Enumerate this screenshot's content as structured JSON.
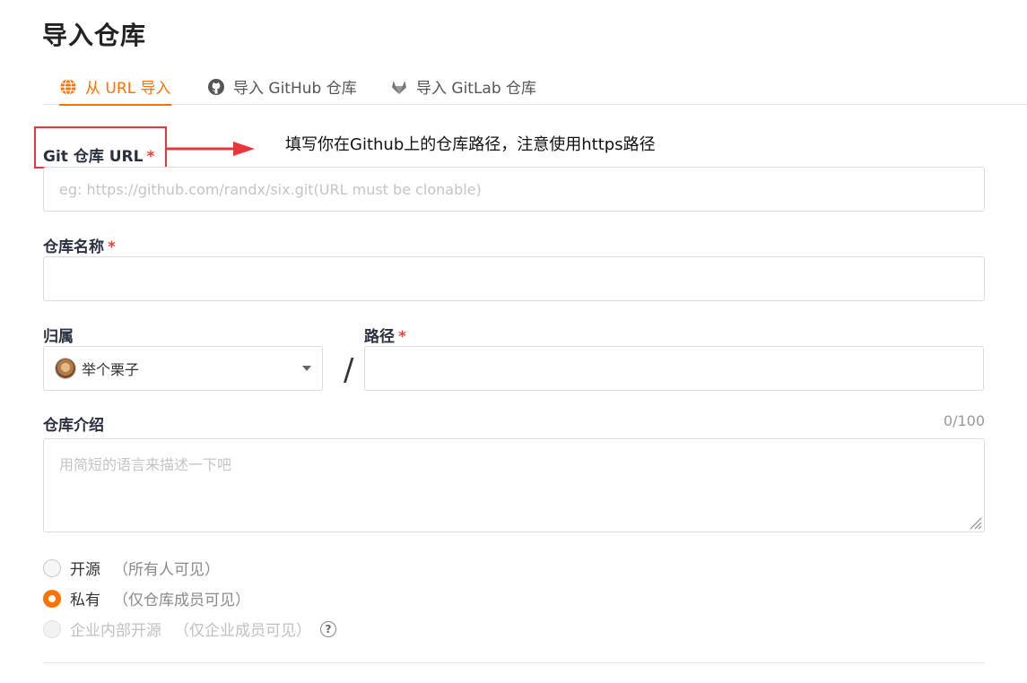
{
  "page": {
    "title": "导入仓库"
  },
  "tabs": [
    {
      "label": "从 URL 导入",
      "icon": "globe-icon"
    },
    {
      "label": "导入 GitHub 仓库",
      "icon": "github-icon"
    },
    {
      "label": "导入 GitLab 仓库",
      "icon": "gitlab-icon"
    }
  ],
  "annotation": {
    "text": "填写你在Github上的仓库路径，注意使用https路径",
    "color": "#e8373c"
  },
  "fields": {
    "git_url": {
      "label": "Git 仓库 URL",
      "required": "*",
      "placeholder": "eg: https://github.com/randx/six.git(URL must be clonable)",
      "value": ""
    },
    "repo_name": {
      "label": "仓库名称",
      "required": "*",
      "value": ""
    },
    "owner": {
      "label": "归属",
      "value": "举个栗子"
    },
    "separator": "/",
    "path": {
      "label": "路径",
      "required": "*",
      "value": ""
    },
    "description": {
      "label": "仓库介绍",
      "counter": "0/100",
      "placeholder": "用简短的语言来描述一下吧",
      "value": ""
    }
  },
  "visibility": [
    {
      "label": "开源",
      "hint": "（所有人可见）",
      "state": "unchecked"
    },
    {
      "label": "私有",
      "hint": "（仅仓库成员可见）",
      "state": "checked"
    },
    {
      "label": "企业内部开源",
      "hint": "（仅企业成员可见）",
      "state": "disabled",
      "help_icon": "?"
    }
  ],
  "colors": {
    "accent": "#fe7300",
    "required": "#e8473a"
  }
}
